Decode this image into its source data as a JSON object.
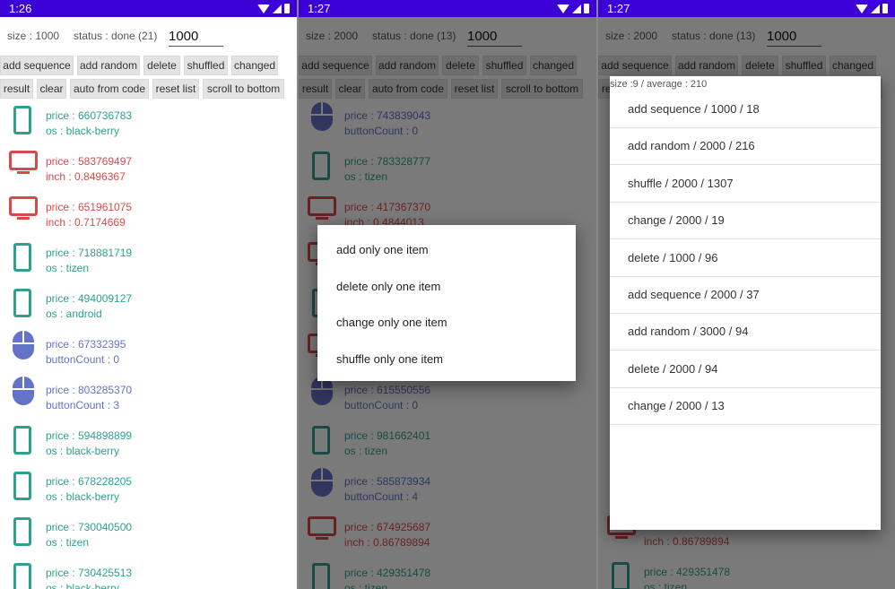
{
  "time_left": "1:26",
  "time_mid": "1:27",
  "time_right": "1:27",
  "panel1": {
    "size": "size : 1000",
    "status": "status : done (21)",
    "input": "1000"
  },
  "panel2": {
    "size": "size : 2000",
    "status": "status : done (13)",
    "input": "1000"
  },
  "panel3": {
    "size": "size : 2000",
    "status": "status : done (13)",
    "input": "1000"
  },
  "buttons": {
    "add_sequence": "add sequence",
    "add_random": "add random",
    "delete": "delete",
    "shuffled": "shuffled",
    "changed": "changed",
    "result": "result",
    "clear": "clear",
    "auto_from_code": "auto from code",
    "reset_list": "reset list",
    "scroll_to_bottom": "scroll to bottom"
  },
  "colors": {
    "statusbar": "#3a00d6",
    "phone": "#2fa08f",
    "tv": "#d74a4a",
    "mouse": "#6472c7"
  },
  "list1": [
    {
      "icon": "phone-icon",
      "l1": "price : 660736783",
      "l2": "os : black-berry"
    },
    {
      "icon": "tv-icon",
      "l1": "price : 583769497",
      "l2": "inch : 0.8496367"
    },
    {
      "icon": "tv-icon",
      "l1": "price : 651961075",
      "l2": "inch : 0.7174669"
    },
    {
      "icon": "phone-icon",
      "l1": "price : 718881719",
      "l2": "os : tizen"
    },
    {
      "icon": "phone-icon",
      "l1": "price : 494009127",
      "l2": "os : android"
    },
    {
      "icon": "mouse-icon",
      "l1": "price : 67332395",
      "l2": "buttonCount : 0"
    },
    {
      "icon": "mouse-icon",
      "l1": "price : 803285370",
      "l2": "buttonCount : 3"
    },
    {
      "icon": "phone-icon",
      "l1": "price : 594898899",
      "l2": "os : black-berry"
    },
    {
      "icon": "phone-icon",
      "l1": "price : 678228205",
      "l2": "os : black-berry"
    },
    {
      "icon": "phone-icon",
      "l1": "price : 730040500",
      "l2": "os : tizen"
    },
    {
      "icon": "phone-icon",
      "l1": "price : 730425513",
      "l2": "os : black-berry"
    }
  ],
  "list2": [
    {
      "icon": "mouse-icon",
      "l1": "price : 743839043",
      "l2": "buttonCount : 0"
    },
    {
      "icon": "phone-icon",
      "l1": "price : 783328777",
      "l2": "os : tizen"
    },
    {
      "icon": "tv-icon",
      "l1": "price : 417367370",
      "l2": "inch : 0.4844013"
    },
    {
      "icon": "tv-icon",
      "l1": "",
      "l2": ""
    },
    {
      "icon": "phone-icon",
      "l1": "",
      "l2": ""
    },
    {
      "icon": "tv-icon",
      "l1": "",
      "l2": ""
    },
    {
      "icon": "mouse-icon",
      "l1": "price : 615550556",
      "l2": "buttonCount : 0"
    },
    {
      "icon": "phone-icon",
      "l1": "price : 981662401",
      "l2": "os : tizen"
    },
    {
      "icon": "mouse-icon",
      "l1": "price : 585873934",
      "l2": "buttonCount : 4"
    },
    {
      "icon": "tv-icon",
      "l1": "price : 674925687",
      "l2": "inch : 0.86789894"
    },
    {
      "icon": "phone-icon",
      "l1": "price : 429351478",
      "l2": "os : tizen"
    }
  ],
  "list3_tail": [
    {
      "icon": "tv-icon",
      "l1": "",
      "l2": "inch : 0.86789894"
    },
    {
      "icon": "phone-icon",
      "l1": "price : 429351478",
      "l2": "os : tizen"
    }
  ],
  "menu": [
    "add only one item",
    "delete only one item",
    "change only one item",
    "shuffle only one item"
  ],
  "result_dialog": {
    "header": "size :9  /  average : 210",
    "rows": [
      "add sequence  / 1000  / 18",
      "add random  / 2000  / 216",
      "shuffle  / 2000  / 1307",
      "change  / 2000  / 19",
      "delete  / 1000  / 96",
      "add sequence  / 2000  / 37",
      "add random  / 3000  / 94",
      "delete  / 2000  / 94",
      "change  / 2000  / 13"
    ]
  }
}
